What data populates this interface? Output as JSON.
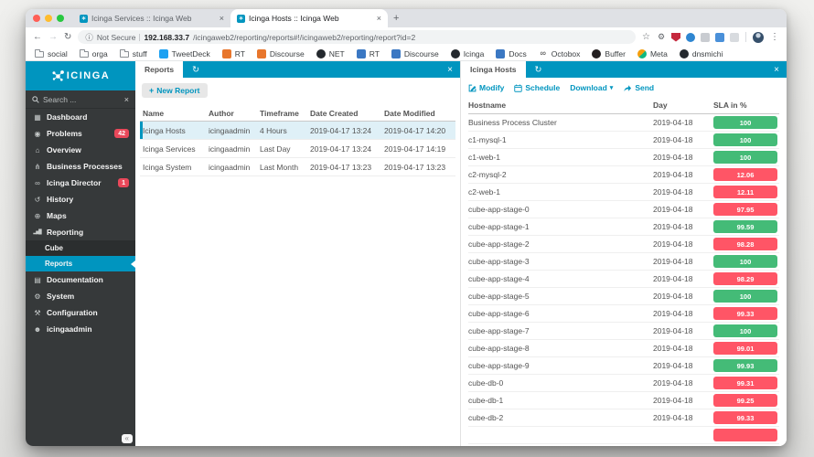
{
  "colors": {
    "brand_teal": "#0095BF",
    "ok_green": "#44BB77",
    "critical_red": "#FF5566",
    "sidebar_bg": "#36393A",
    "badge_red": "#E9485A",
    "selected_row": "#DFF0F7"
  },
  "icons": {
    "favicon": "∗",
    "close": "×",
    "plus": "+",
    "back": "←",
    "forward": "→",
    "reload": "↻",
    "info": "ⓘ",
    "star": "☆",
    "menu_dots": "⋮",
    "refresh": "↻",
    "caret_down": "▾",
    "collapse": "«",
    "search_clear": "×"
  },
  "browser": {
    "tabs": [
      {
        "title": "Icinga Services :: Icinga Web"
      },
      {
        "title": "Icinga Hosts :: Icinga Web"
      }
    ],
    "url": {
      "security_label": "Not Secure",
      "host": "192.168.33.7",
      "path": "/icingaweb2/reporting/reports#!/icingaweb2/reporting/report?id=2"
    },
    "extensions": [
      {
        "name": "gear-extension-icon",
        "glyph": "⚙",
        "fg": "#5F6368",
        "shape": "plain"
      },
      {
        "name": "shield-extension-icon",
        "shape": "shield",
        "bg": "#C5283D"
      },
      {
        "name": "blue-circle-extension-icon",
        "shape": "circle",
        "bg": "#2E86D1"
      },
      {
        "name": "grey-square-extension-icon",
        "shape": "square",
        "bg": "#C9CCD1"
      },
      {
        "name": "blue-square-extension-icon",
        "shape": "square",
        "bg": "#4A90D9"
      },
      {
        "name": "puzzle-extension-icon",
        "shape": "square",
        "bg": "#D8DBDF"
      }
    ],
    "bookmarks": [
      {
        "name": "bookmark-social",
        "icon": "folder-icon",
        "type": "folder",
        "label": "social"
      },
      {
        "name": "bookmark-orga",
        "icon": "folder-icon",
        "type": "folder",
        "label": "orga"
      },
      {
        "name": "bookmark-stuff",
        "icon": "folder-icon",
        "type": "folder",
        "label": "stuff"
      },
      {
        "name": "bookmark-tweetdeck",
        "icon": "tweetdeck-icon",
        "type": "square",
        "bg": "#1DA1F2",
        "label": "TweetDeck"
      },
      {
        "name": "bookmark-rt-orange",
        "icon": "rt-icon",
        "type": "square",
        "bg": "#E8762C",
        "label": "RT"
      },
      {
        "name": "bookmark-discourse-orange",
        "icon": "discourse-icon",
        "type": "square",
        "bg": "#E8762C",
        "label": "Discourse"
      },
      {
        "name": "bookmark-net",
        "icon": "github-icon",
        "type": "github",
        "label": "NET"
      },
      {
        "name": "bookmark-rt-blue",
        "icon": "rt-icon",
        "type": "square",
        "bg": "#3B78C3",
        "label": "RT"
      },
      {
        "name": "bookmark-discourse-blue",
        "icon": "discourse-icon",
        "type": "square",
        "bg": "#3B78C3",
        "label": "Discourse"
      },
      {
        "name": "bookmark-icinga",
        "icon": "github-icon",
        "type": "github",
        "label": "Icinga"
      },
      {
        "name": "bookmark-docs",
        "icon": "docs-icon",
        "type": "square",
        "bg": "#3B78C3",
        "label": "Docs"
      },
      {
        "name": "bookmark-octobox",
        "icon": "octobox-icon",
        "type": "glyph",
        "glyph": "∞",
        "label": "Octobox"
      },
      {
        "name": "bookmark-buffer",
        "icon": "buffer-icon",
        "type": "circle",
        "bg": "#231F20",
        "label": "Buffer"
      },
      {
        "name": "bookmark-meta",
        "icon": "meta-icon",
        "type": "meta",
        "label": "Meta"
      },
      {
        "name": "bookmark-dnsmichi",
        "icon": "github-icon",
        "type": "github",
        "label": "dnsmichi"
      }
    ]
  },
  "sidebar": {
    "logo_text": "ICINGA",
    "search_placeholder": "Search ...",
    "items": [
      {
        "label": "Dashboard",
        "glyph": "▦"
      },
      {
        "label": "Problems",
        "glyph": "◉",
        "badge": "42"
      },
      {
        "label": "Overview",
        "glyph": "⌂"
      },
      {
        "label": "Business Processes",
        "glyph": "⋔"
      },
      {
        "label": "Icinga Director",
        "glyph": "∞",
        "badge": "1"
      },
      {
        "label": "History",
        "glyph": "↺"
      },
      {
        "label": "Maps",
        "glyph": "⊕"
      },
      {
        "label": "Reporting",
        "glyph": "▂▅█"
      },
      {
        "label": "Cube"
      },
      {
        "label": "Reports"
      },
      {
        "label": "Documentation",
        "glyph": "▤"
      },
      {
        "label": "System",
        "glyph": "⚙"
      },
      {
        "label": "Configuration",
        "glyph": "⚒"
      },
      {
        "label": "icingaadmin",
        "glyph": "☻"
      }
    ]
  },
  "reports_panel": {
    "tab_label": "Reports",
    "new_report_label": "New Report",
    "columns": [
      "Name",
      "Author",
      "Timeframe",
      "Date Created",
      "Date Modified"
    ],
    "rows": [
      {
        "name": "Icinga Hosts",
        "author": "icingaadmin",
        "timeframe": "4 Hours",
        "created": "2019-04-17 13:24",
        "modified": "2019-04-17 14:20",
        "state": "selected"
      },
      {
        "name": "Icinga Services",
        "author": "icingaadmin",
        "timeframe": "Last Day",
        "created": "2019-04-17 13:24",
        "modified": "2019-04-17 14:19",
        "state": ""
      },
      {
        "name": "Icinga System",
        "author": "icingaadmin",
        "timeframe": "Last Month",
        "created": "2019-04-17 13:23",
        "modified": "2019-04-17 13:23",
        "state": ""
      }
    ]
  },
  "report_panel": {
    "tab_label": "Icinga Hosts",
    "actions": {
      "modify": "Modify",
      "schedule": "Schedule",
      "download": "Download",
      "send": "Send"
    },
    "columns": [
      "Hostname",
      "Day",
      "SLA in %"
    ],
    "rows": [
      {
        "hostname": "Business Process Cluster",
        "day": "2019-04-18",
        "sla": "100",
        "status": "ok"
      },
      {
        "hostname": "c1-mysql-1",
        "day": "2019-04-18",
        "sla": "100",
        "status": "ok"
      },
      {
        "hostname": "c1-web-1",
        "day": "2019-04-18",
        "sla": "100",
        "status": "ok"
      },
      {
        "hostname": "c2-mysql-2",
        "day": "2019-04-18",
        "sla": "12.06",
        "status": "critical"
      },
      {
        "hostname": "c2-web-1",
        "day": "2019-04-18",
        "sla": "12.11",
        "status": "critical"
      },
      {
        "hostname": "cube-app-stage-0",
        "day": "2019-04-18",
        "sla": "97.95",
        "status": "critical"
      },
      {
        "hostname": "cube-app-stage-1",
        "day": "2019-04-18",
        "sla": "99.59",
        "status": "ok"
      },
      {
        "hostname": "cube-app-stage-2",
        "day": "2019-04-18",
        "sla": "98.28",
        "status": "critical"
      },
      {
        "hostname": "cube-app-stage-3",
        "day": "2019-04-18",
        "sla": "100",
        "status": "ok"
      },
      {
        "hostname": "cube-app-stage-4",
        "day": "2019-04-18",
        "sla": "98.29",
        "status": "critical"
      },
      {
        "hostname": "cube-app-stage-5",
        "day": "2019-04-18",
        "sla": "100",
        "status": "ok"
      },
      {
        "hostname": "cube-app-stage-6",
        "day": "2019-04-18",
        "sla": "99.33",
        "status": "critical"
      },
      {
        "hostname": "cube-app-stage-7",
        "day": "2019-04-18",
        "sla": "100",
        "status": "ok"
      },
      {
        "hostname": "cube-app-stage-8",
        "day": "2019-04-18",
        "sla": "99.01",
        "status": "critical"
      },
      {
        "hostname": "cube-app-stage-9",
        "day": "2019-04-18",
        "sla": "99.93",
        "status": "ok"
      },
      {
        "hostname": "cube-db-0",
        "day": "2019-04-18",
        "sla": "99.31",
        "status": "critical"
      },
      {
        "hostname": "cube-db-1",
        "day": "2019-04-18",
        "sla": "99.25",
        "status": "critical"
      },
      {
        "hostname": "cube-db-2",
        "day": "2019-04-18",
        "sla": "99.33",
        "status": "critical"
      },
      {
        "hostname": "",
        "day": "",
        "sla": "",
        "status": "critical"
      }
    ]
  }
}
